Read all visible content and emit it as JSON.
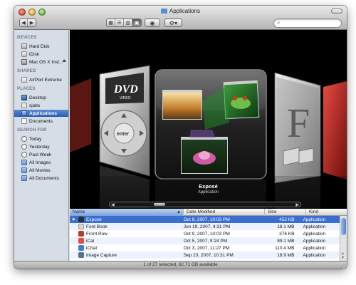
{
  "window": {
    "title": "Applications"
  },
  "toolbar": {
    "back_icon": "back-arrow-icon",
    "forward_icon": "forward-arrow-icon",
    "view_icons": [
      "icon-view-icon",
      "list-view-icon",
      "column-view-icon",
      "coverflow-view-icon"
    ],
    "active_view": "coverflow",
    "search": {
      "value": "",
      "placeholder": ""
    }
  },
  "sidebar": {
    "sections": [
      {
        "title": "DEVICES",
        "items": [
          {
            "label": "Hard Disk",
            "icon": "hard-disk-icon"
          },
          {
            "label": "iDisk",
            "icon": "idisk-icon"
          },
          {
            "label": "Mac OS X Inst...",
            "icon": "install-disk-icon",
            "eject": "⏏"
          }
        ]
      },
      {
        "title": "SHARED",
        "items": [
          {
            "label": "AirPort Extreme",
            "icon": "network-icon"
          }
        ]
      },
      {
        "title": "PLACES",
        "items": [
          {
            "label": "Desktop",
            "icon": "desktop-icon"
          },
          {
            "label": "sjobs",
            "icon": "home-icon"
          },
          {
            "label": "Applications",
            "icon": "applications-icon",
            "selected": true
          },
          {
            "label": "Documents",
            "icon": "documents-icon"
          }
        ]
      },
      {
        "title": "SEARCH FOR",
        "items": [
          {
            "label": "Today",
            "icon": "clock-icon"
          },
          {
            "label": "Yesterday",
            "icon": "clock-icon"
          },
          {
            "label": "Past Week",
            "icon": "clock-icon"
          },
          {
            "label": "All Images",
            "icon": "smart-folder-icon"
          },
          {
            "label": "All Movies",
            "icon": "smart-folder-icon"
          },
          {
            "label": "All Documents",
            "icon": "smart-folder-icon"
          }
        ]
      }
    ]
  },
  "coverflow": {
    "selected_title": "Exposé",
    "selected_kind": "Application",
    "left_cover_text": "DVD",
    "left_cover_subtext": "VIDEO",
    "enter_label": "enter",
    "right_cover_letter": "F"
  },
  "list": {
    "columns": {
      "name": "Name",
      "date": "Date Modified",
      "size": "Size",
      "kind": "Kind"
    },
    "sort_indicator": "▲",
    "rows": [
      {
        "name": "Exposé",
        "date": "Oct 9, 2007, 10:03 PM",
        "size": "452 KB",
        "kind": "Application",
        "selected": true,
        "color": "#2f2f2f"
      },
      {
        "name": "Font Book",
        "date": "Jun 19, 2007, 4:31 PM",
        "size": "18.1 MB",
        "kind": "Application",
        "color": "#d6d6d6"
      },
      {
        "name": "Front Row",
        "date": "Oct 9, 2007, 10:03 PM",
        "size": "376 KB",
        "kind": "Application",
        "color": "#c0392b"
      },
      {
        "name": "iCal",
        "date": "Oct 5, 2007, 9:24 PM",
        "size": "89.1 MB",
        "kind": "Application",
        "color": "#e74c3c"
      },
      {
        "name": "iChat",
        "date": "Oct 3, 2007, 11:27 PM",
        "size": "110.4 MB",
        "kind": "Application",
        "color": "#3b7fd9"
      },
      {
        "name": "Image Capture",
        "date": "Sep 23, 2007, 10:31 PM",
        "size": "18.9 MB",
        "kind": "Application",
        "color": "#5a6f8c"
      }
    ]
  },
  "status": {
    "text": "1 of 27 selected, 62.71 GB available"
  }
}
